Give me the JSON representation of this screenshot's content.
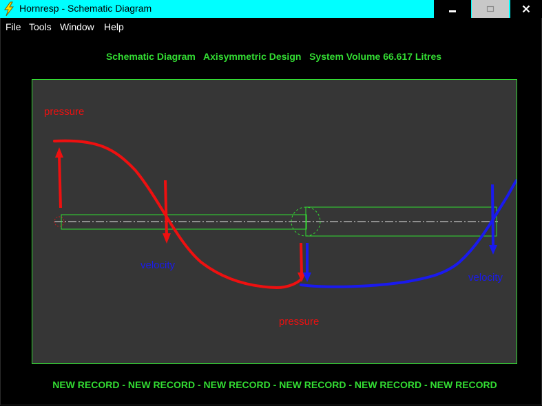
{
  "window": {
    "title": "Hornresp - Schematic Diagram",
    "titlebar_color": "#00ffff",
    "icon": "lightning-bolt-icon"
  },
  "menu": {
    "file": "File",
    "tools": "Tools",
    "window": "Window",
    "help": "Help"
  },
  "info_line": "Schematic Diagram   Axisymmetric Design   System Volume 66.617 Litres",
  "annotations": {
    "pressure_top": "pressure",
    "velocity_left": "velocity",
    "pressure_bottom": "pressure",
    "velocity_right": "velocity"
  },
  "colors": {
    "panel_bg": "#363636",
    "schematic_lines": "#33dd33",
    "pressure": "#ee1010",
    "velocity": "#1a1aee"
  },
  "footer": "NEW RECORD - NEW RECORD - NEW RECORD - NEW RECORD - NEW RECORD - NEW RECORD"
}
